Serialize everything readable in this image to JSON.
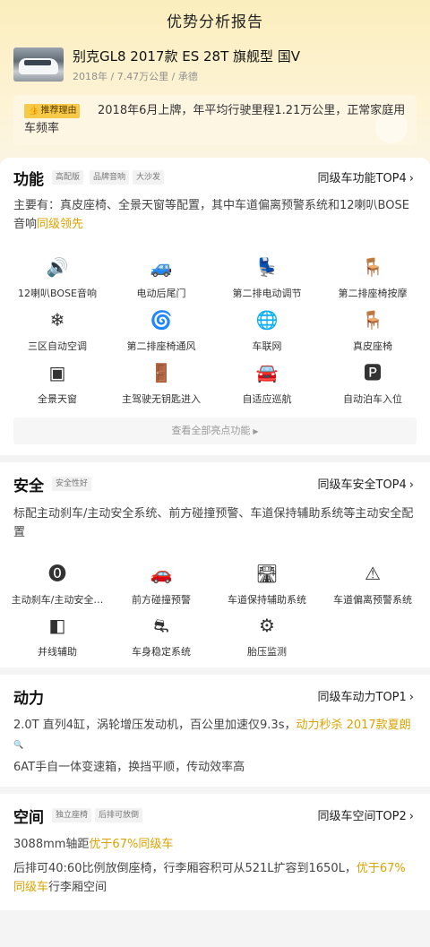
{
  "header": {
    "title": "优势分析报告"
  },
  "car": {
    "name": "别克GL8 2017款 ES 28T 旗舰型 国V",
    "meta": "2018年 / 7.47万公里 / 承德"
  },
  "reason": {
    "badge": "推荐理由",
    "text": "2018年6月上牌，年平均行驶里程1.21万公里，正常家庭用车频率"
  },
  "features": {
    "title": "功能",
    "tags": [
      "高配版",
      "品牌音响",
      "大沙发"
    ],
    "rank": "同级车功能TOP4",
    "desc_main": "主要有：真皮座椅、全景天窗等配置，其中车道偏离预警系统和12喇叭BOSE音响",
    "desc_hl": "同级领先",
    "items": [
      {
        "label": "12喇叭BOSE音响",
        "icon": "speaker-icon"
      },
      {
        "label": "电动后尾门",
        "icon": "power-tailgate-icon"
      },
      {
        "label": "第二排电动调节",
        "icon": "power-seat-adjust-icon"
      },
      {
        "label": "第二排座椅按摩",
        "icon": "seat-massage-icon"
      },
      {
        "label": "三区自动空调",
        "icon": "air-conditioner-icon"
      },
      {
        "label": "第二排座椅通风",
        "icon": "seat-ventilation-icon"
      },
      {
        "label": "车联网",
        "icon": "connected-globe-icon"
      },
      {
        "label": "真皮座椅",
        "icon": "leather-seat-icon"
      },
      {
        "label": "全景天窗",
        "icon": "panoramic-sunroof-icon"
      },
      {
        "label": "主驾驶无钥匙进入",
        "icon": "keyless-door-icon"
      },
      {
        "label": "自适应巡航",
        "icon": "adaptive-cruise-icon"
      },
      {
        "label": "自动泊车入位",
        "icon": "auto-parking-icon"
      }
    ],
    "see_all": "查看全部亮点功能"
  },
  "safety": {
    "title": "安全",
    "tags": [
      "安全性好"
    ],
    "rank": "同级车安全TOP4",
    "desc": "标配主动刹车/主动安全系统、前方碰撞预警、车道保持辅助系统等主动安全配置",
    "items": [
      {
        "label": "主动刹车/主动安全…",
        "icon": "active-brake-icon"
      },
      {
        "label": "前方碰撞预警",
        "icon": "collision-warning-icon"
      },
      {
        "label": "车道保持辅助系统",
        "icon": "lane-keep-icon"
      },
      {
        "label": "车道偏离预警系统",
        "icon": "lane-departure-icon"
      },
      {
        "label": "并线辅助",
        "icon": "blind-spot-mirror-icon"
      },
      {
        "label": "车身稳定系统",
        "icon": "stability-control-icon"
      },
      {
        "label": "胎压监测",
        "icon": "tire-pressure-icon"
      }
    ]
  },
  "power": {
    "title": "动力",
    "rank": "同级车动力TOP1",
    "desc1_main": "2.0T 直列4缸，涡轮增压发动机，百公里加速仅9.3s，",
    "desc1_hl": "动力秒杀 2017款夏朗",
    "desc2": "6AT手自一体变速箱，换挡平顺，传动效率高"
  },
  "space": {
    "title": "空间",
    "tags": [
      "独立座椅",
      "后排可放倒"
    ],
    "rank": "同级车空间TOP2",
    "desc1_main": "3088mm轴距",
    "desc1_hl": "优于67%同级车",
    "desc2_main": "后排可40:60比例放倒座椅，行李厢容积可从521L扩容到1650L，",
    "desc2_hl": "优于67%同级车",
    "desc2_tail": "行李厢空间"
  },
  "colors": {
    "accent": "#d9a300",
    "badge": "#f7c948",
    "header_bg": "#fbeebd"
  }
}
